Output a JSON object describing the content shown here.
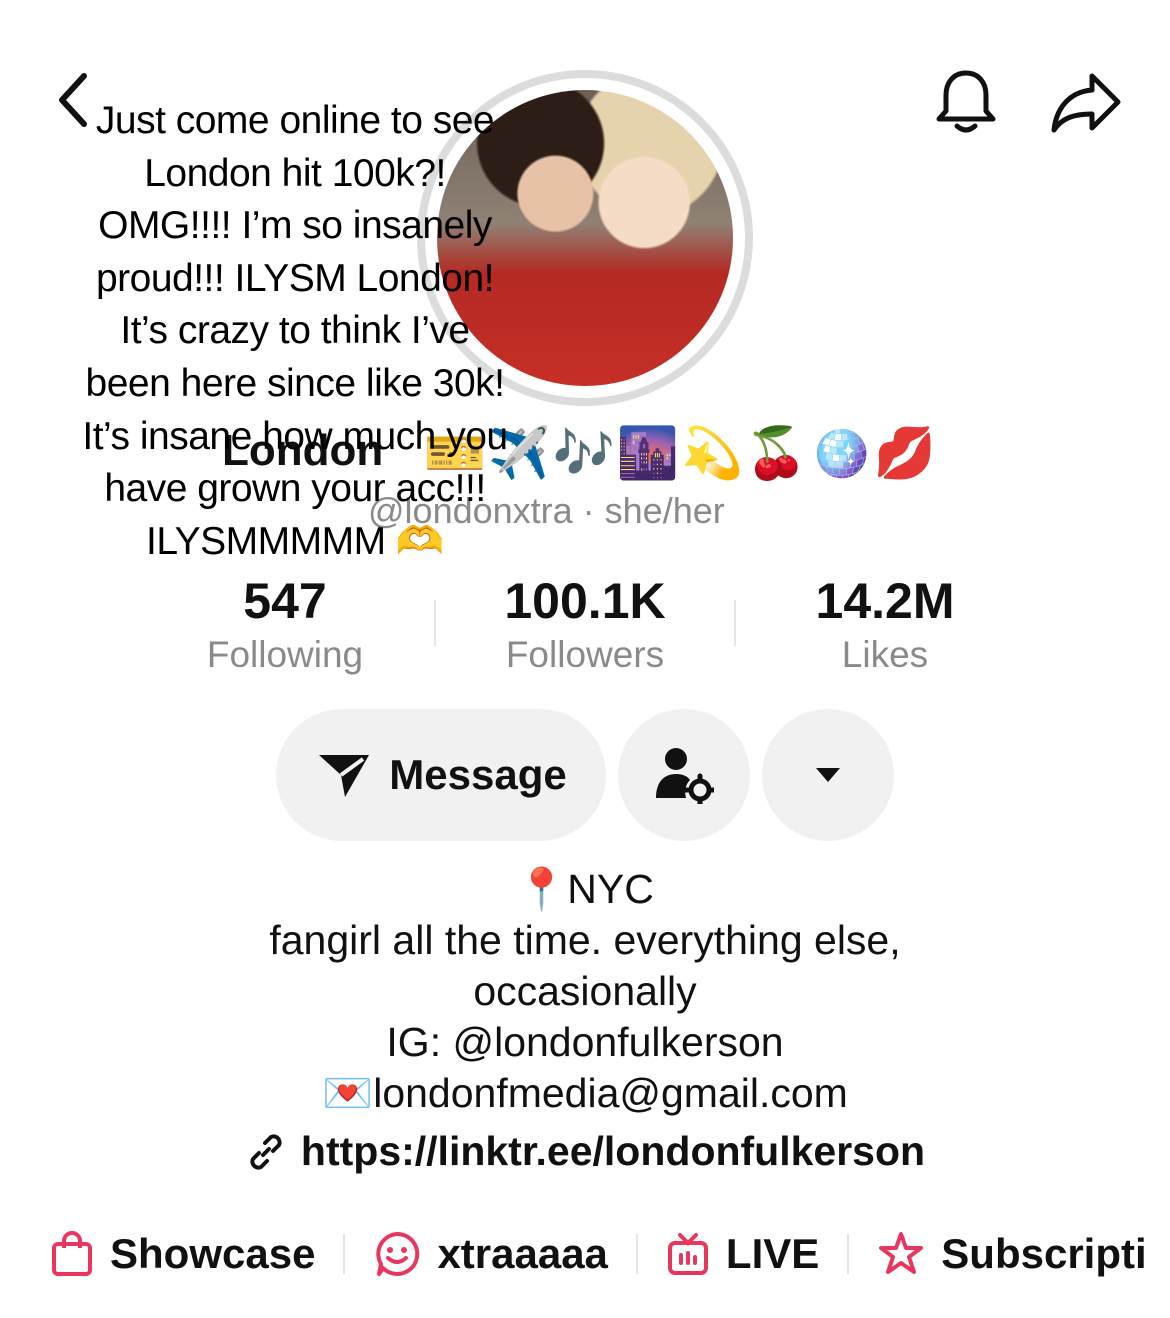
{
  "caption": {
    "lines": [
      "Just come online to see",
      "London hit 100k?!",
      "OMG!!!! I’m so insanely",
      "proud!!! ILYSM London!",
      "It’s crazy to think I’ve",
      "been here since like 30k!",
      "It’s insane how much you",
      "have grown your acc!!!",
      "ILYSMMMMM 🫶"
    ]
  },
  "profile": {
    "name": "London",
    "name_emojis": "🎫✈️🎶🌆💫🍒🪩💋",
    "handle": "@londonxtra · she/her"
  },
  "stats": [
    {
      "value": "547",
      "label": "Following"
    },
    {
      "value": "100.1K",
      "label": "Followers"
    },
    {
      "value": "14.2M",
      "label": "Likes"
    }
  ],
  "actions": {
    "message_label": "Message"
  },
  "bio": {
    "lines": [
      "📍NYC",
      "fangirl all the time. everything else,",
      "occasionally",
      "IG: @londonfulkerson",
      "💌londonfmedia@gmail.com"
    ],
    "link": "https://linktr.ee/londonfulkerson"
  },
  "tabs": [
    {
      "label": "Showcase",
      "icon": "shopping-bag-icon"
    },
    {
      "label": "xtraaaaa",
      "icon": "smiley-bubble-icon"
    },
    {
      "label": "LIVE",
      "icon": "tv-icon"
    },
    {
      "label": "Subscripti",
      "icon": "star-icon"
    }
  ],
  "colors": {
    "accent": "#e8375f",
    "muted": "#8a8a8a",
    "button_bg": "#f1f1f1"
  }
}
